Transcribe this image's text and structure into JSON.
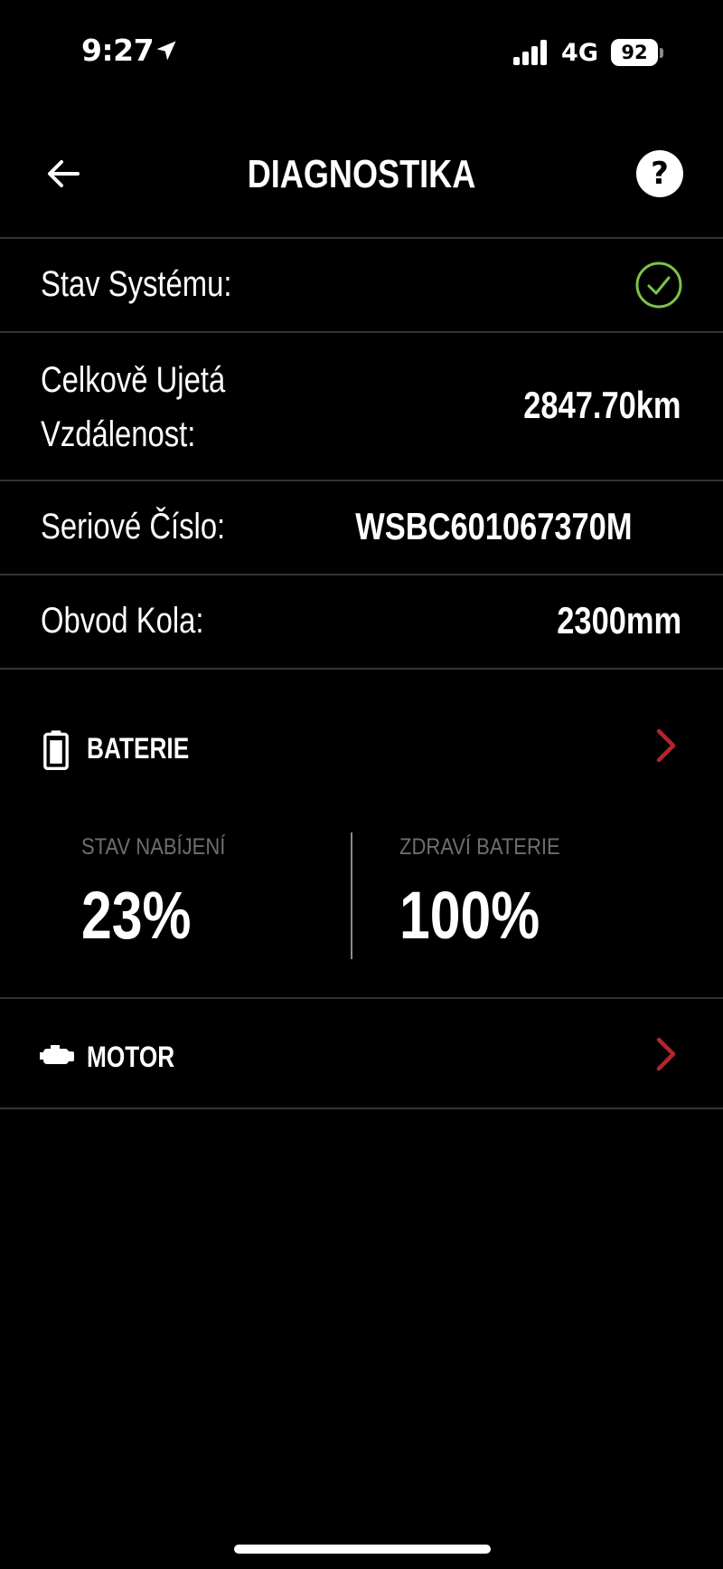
{
  "status_bar": {
    "time": "9:27",
    "network": "4G",
    "battery_level": "92"
  },
  "header": {
    "title": "DIAGNOSTIKA",
    "help_label": "?"
  },
  "info_rows": {
    "system_status": {
      "label": "Stav Systému:",
      "status": "ok"
    },
    "total_distance": {
      "label_line1": "Celkově Ujetá",
      "label_line2": "Vzdálenost:",
      "value": "2847.70km"
    },
    "serial_number": {
      "label": "Seriové Číslo:",
      "value": "WSBC601067370M"
    },
    "wheel_circumference": {
      "label": "Obvod Kola:",
      "value": "2300mm"
    }
  },
  "battery_section": {
    "title": "BATERIE",
    "charge_label": "STAV NABÍJENÍ",
    "charge_value": "23%",
    "health_label": "ZDRAVÍ BATERIE",
    "health_value": "100%"
  },
  "motor_section": {
    "title": "MOTOR"
  },
  "colors": {
    "background": "#000000",
    "text": "#ffffff",
    "divider": "#333333",
    "status_ok": "#7cc24a",
    "chevron": "#b3262b",
    "muted_label": "#6e6e6e"
  },
  "icons": {
    "back": "arrow-left-icon",
    "help": "question-circle-icon",
    "status_ok": "check-circle-icon",
    "battery": "battery-icon",
    "motor": "motor-icon",
    "chevron": "chevron-right-icon"
  }
}
